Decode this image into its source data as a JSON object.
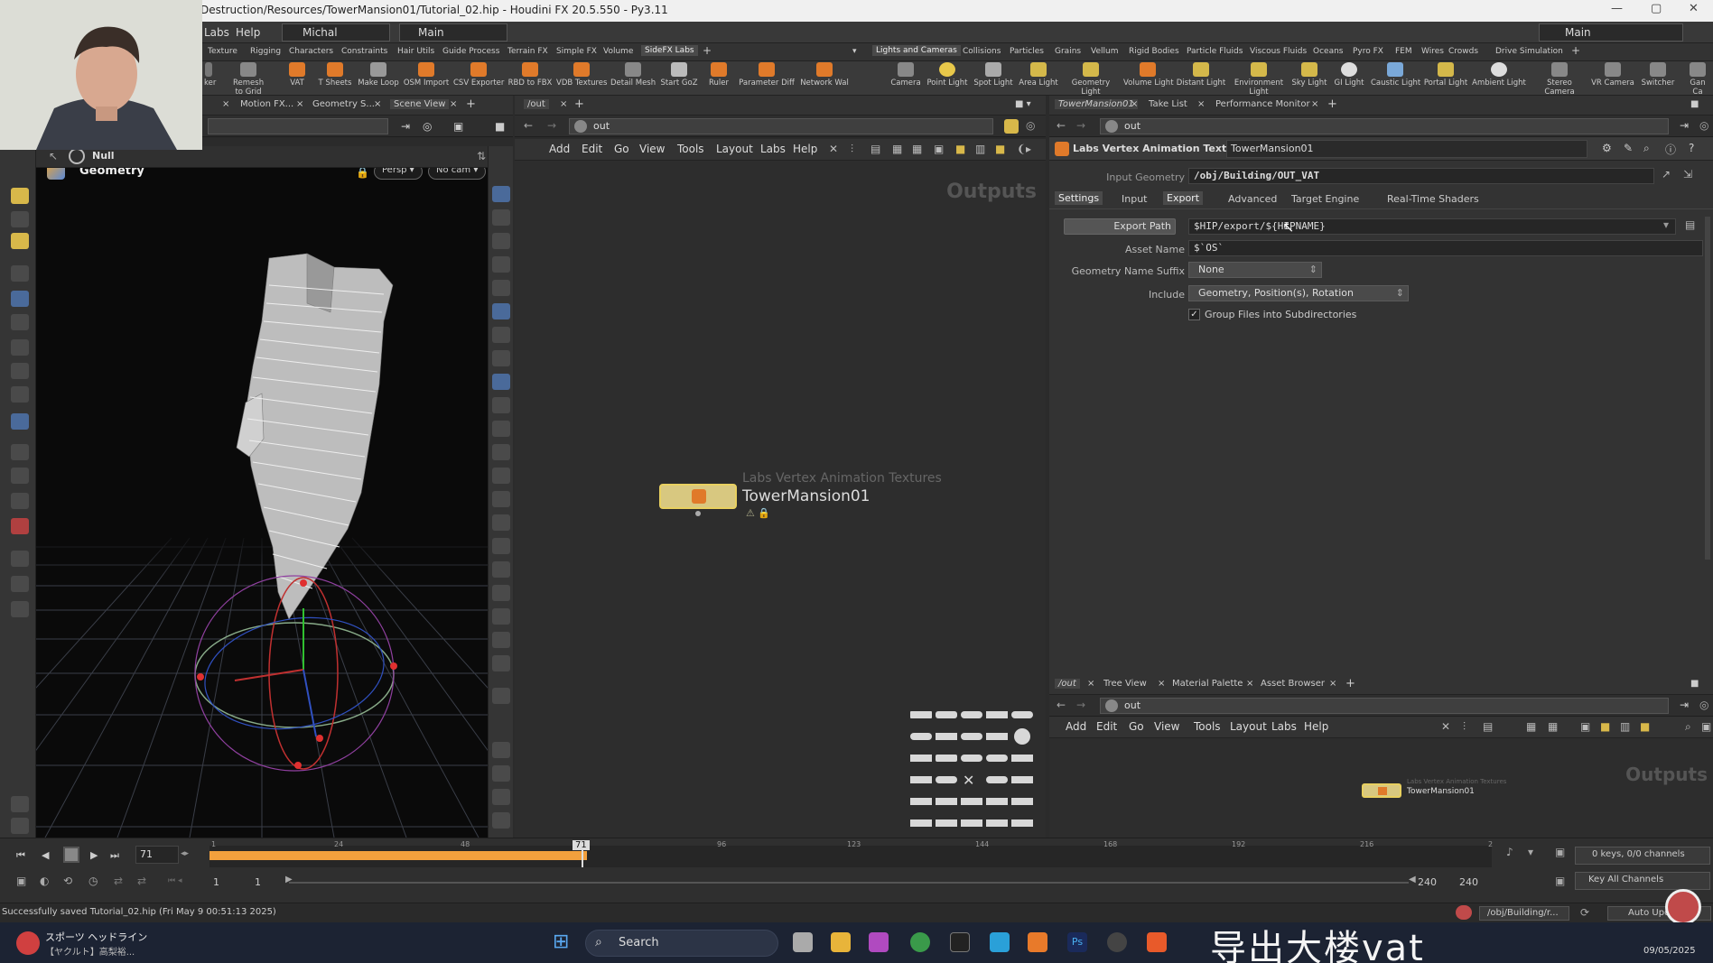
{
  "window": {
    "title": "Destruction/Resources/TowerMansion01/Tutorial_02.hip - Houdini FX 20.5.550 - Py3.11"
  },
  "menubar": {
    "items": [
      "Labs",
      "Help"
    ],
    "desktop": "Michal",
    "context": "Main",
    "right_desktop": "Main"
  },
  "shelf_tabs_left": [
    "Texture",
    "Rigging",
    "Characters",
    "Constraints",
    "Hair Utils",
    "Guide Process",
    "Terrain FX",
    "Simple FX",
    "Volume",
    "SideFX Labs"
  ],
  "shelf_tabs_right": [
    "Lights and Cameras",
    "Collisions",
    "Particles",
    "Grains",
    "Vellum",
    "Rigid Bodies",
    "Particle Fluids",
    "Viscous Fluids",
    "Oceans",
    "Pyro FX",
    "FEM",
    "Wires",
    "Crowds",
    "Drive Simulation"
  ],
  "shelf_tools_left": [
    "ker",
    "Remesh to Grid",
    "VAT",
    "T Sheets",
    "Make Loop",
    "OSM Import",
    "CSV Exporter",
    "RBD to FBX",
    "VDB Textures",
    "Detail Mesh",
    "Start GoZ",
    "Ruler",
    "Parameter Diff",
    "Network Wal"
  ],
  "shelf_tools_right": [
    "Camera",
    "Point Light",
    "Spot Light",
    "Area Light",
    "Geometry Light",
    "Volume Light",
    "Distant Light",
    "Environment Light",
    "Sky Light",
    "GI Light",
    "Caustic Light",
    "Portal Light",
    "Ambient Light",
    "Stereo Camera",
    "VR Camera",
    "Switcher",
    "Gan Ca"
  ],
  "left_pane": {
    "tabs": [
      "Motion FX...",
      "Geometry S...",
      "Scene View"
    ],
    "node_label": "Null"
  },
  "viewport": {
    "label": "Geometry",
    "persp": "Persp",
    "cam": "No cam"
  },
  "network": {
    "tab": "/out",
    "path": "out",
    "menu": [
      "Add",
      "Edit",
      "Go",
      "View",
      "Tools",
      "Layout",
      "Labs",
      "Help"
    ],
    "context_label": "Outputs",
    "node_type": "Labs Vertex Animation Textures",
    "node_name": "TowerMansion01"
  },
  "params": {
    "tabs": [
      "TowerMansion01",
      "Take List",
      "Performance Monitor"
    ],
    "path": "out",
    "node_type": "Labs Vertex Animation Textures",
    "node_name": "TowerMansion01",
    "input_geometry_label": "Input Geometry",
    "input_geometry": "/obj/Building/OUT_VAT",
    "section_tabs": [
      "Settings",
      "Input",
      "Export",
      "Advanced",
      "Target Engine",
      "Real-Time Shaders"
    ],
    "export_path_label": "Export Path",
    "export_path": "$HIP/export/${HIPNAME}",
    "asset_name_label": "Asset Name",
    "asset_name": "$`OS`",
    "suffix_label": "Geometry Name Suffix",
    "suffix": "None",
    "include_label": "Include",
    "include": "Geometry, Position(s), Rotation",
    "group_label": "Group Files into Subdirectories"
  },
  "network2": {
    "tabs": [
      "/out",
      "Tree View",
      "Material Palette",
      "Asset Browser"
    ],
    "path": "out",
    "menu": [
      "Add",
      "Edit",
      "Go",
      "View",
      "Tools",
      "Layout",
      "Labs",
      "Help"
    ],
    "context_label": "Outputs",
    "node_type": "Labs Vertex Animation Textures",
    "node_name": "TowerMansion01"
  },
  "timeline": {
    "frame": "71",
    "marker": "71",
    "ticks": [
      "1",
      "24",
      "48",
      "96",
      "123",
      "144",
      "168",
      "192",
      "216",
      "2"
    ],
    "start": "1",
    "start2": "1",
    "end": "240",
    "end2": "240",
    "keys": "0 keys, 0/0 channels",
    "key_all": "Key All Channels"
  },
  "status": {
    "message": "Successfully saved Tutorial_02.hip (Fri May  9 00:51:13 2025)",
    "path": "/obj/Building/r...",
    "auto": "Auto Upda"
  },
  "taskbar": {
    "news_title": "スポーツ ヘッドライン",
    "news_sub": "【ヤクルト】高梨裕...",
    "search": "Search",
    "date": "09/05/2025"
  },
  "caption": "导出大楼vat",
  "colors": {
    "accent": "#f2a03d",
    "node": "#e8d060"
  }
}
